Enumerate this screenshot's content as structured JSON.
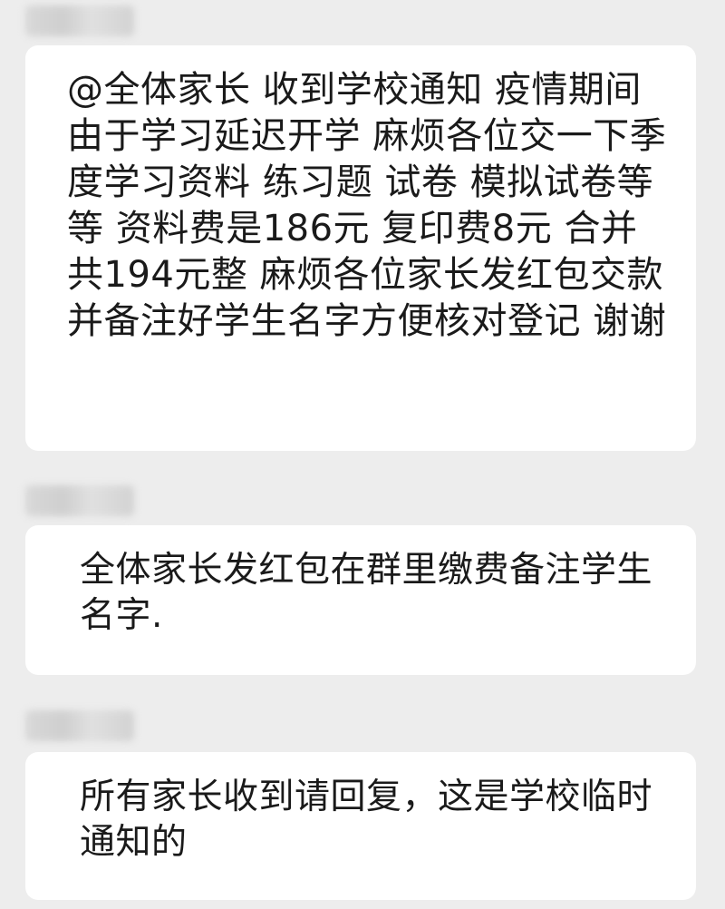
{
  "messages": [
    {
      "sender": "",
      "text": "@全体家长 收到学校通知 疫情期间由于学习延迟开学 麻烦各位交一下季度学习资料 练习题 试卷 模拟试卷等等 资料费是186元 复印费8元 合并共194元整 麻烦各位家长发红包交款 并备注好学生名字方便核对登记 谢谢"
    },
    {
      "sender": "",
      "text": "全体家长发红包在群里缴费备注学生名字."
    },
    {
      "sender": "",
      "text": "所有家长收到请回复，这是学校临时通知的"
    }
  ],
  "colors": {
    "background": "#ededed",
    "bubble": "#ffffff",
    "text": "#1a1a1a"
  }
}
